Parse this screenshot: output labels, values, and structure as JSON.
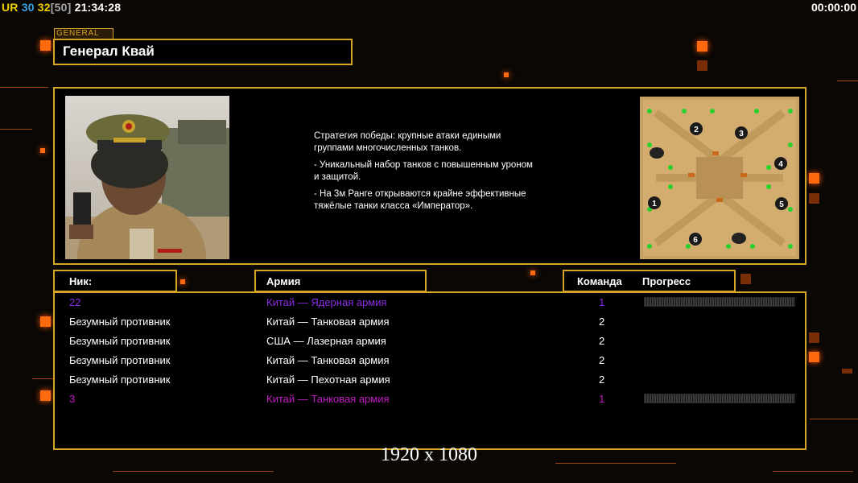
{
  "hud": {
    "ur": "UR",
    "fps": "30",
    "count": "32",
    "cap": "[50]",
    "clock": "21:34:28"
  },
  "timer": "00:00:00",
  "general": {
    "tag": "GENERAL",
    "name": "Генерал Квай"
  },
  "strategy": [
    "Стратегия победы: крупные атаки едиными\n группами многочисленных танков.",
    "- Уникальный набор танков с повышенным уроном\n и защитой.",
    "- На 3м Ранге открываются крайне эффективные\n тяжёлые танки класса «Император»."
  ],
  "headers": {
    "nick": "Ник:",
    "army": "Армия",
    "team": "Команда",
    "progress": "Прогресс"
  },
  "players": [
    {
      "nick": "22",
      "army": "Китай — Ядерная армия",
      "team": "1",
      "color": "#8a2be2",
      "progress": true
    },
    {
      "nick": "Безумный противник",
      "army": "Китай — Танковая армия",
      "team": "2",
      "color": "#ffffff",
      "progress": false
    },
    {
      "nick": "Безумный противник",
      "army": "США — Лазерная армия",
      "team": "2",
      "color": "#ffffff",
      "progress": false
    },
    {
      "nick": "Безумный противник",
      "army": "Китай — Танковая армия",
      "team": "2",
      "color": "#ffffff",
      "progress": false
    },
    {
      "nick": "Безумный противник",
      "army": "Китай — Пехотная армия",
      "team": "2",
      "color": "#ffffff",
      "progress": false
    },
    {
      "nick": "3",
      "army": "Китай — Танковая армия",
      "team": "1",
      "color": "#c21ac2",
      "progress": true
    }
  ],
  "minimap": {
    "spawns": [
      "1",
      "2",
      "3",
      "4",
      "5",
      "6"
    ]
  },
  "resolution": "1920 x 1080",
  "colors": {
    "accent": "#d6a526",
    "glow": "#ff6a10"
  },
  "icons": {
    "portrait": "general-portrait-image",
    "map": "minimap-image"
  }
}
